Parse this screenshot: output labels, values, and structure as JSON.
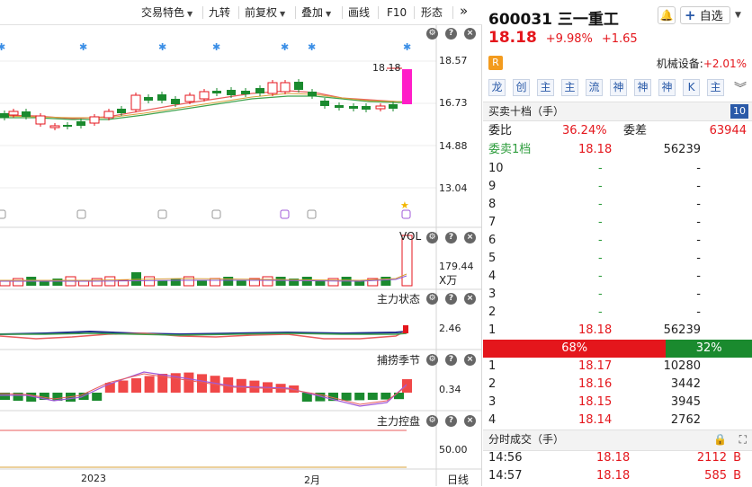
{
  "toolbar": {
    "trade_features": "交易特色",
    "nine_turns": "九转",
    "forward_adjust": "前复权",
    "overlay": "叠加",
    "draw_line": "画线",
    "f10": "F10",
    "pattern": "形态",
    "expand_icon": "double-chevron-right-icon"
  },
  "main_chart": {
    "y_ticks": [
      "18.57",
      "16.73",
      "14.88",
      "13.04"
    ],
    "last_price_label": "18.18",
    "ohlc_note": "candlestick daily bars"
  },
  "vol_panel": {
    "title": "VOL",
    "value": "179.44",
    "unit": "X万"
  },
  "main_force_panel": {
    "title": "主力状态",
    "value": "2.46"
  },
  "season_panel": {
    "title": "捕捞季节",
    "value": "0.34"
  },
  "control_panel": {
    "title": "主力控盘",
    "value": "50.00"
  },
  "x_axis": {
    "labels": [
      "2023",
      "2月"
    ],
    "period": "日线"
  },
  "stock": {
    "code": "600031",
    "name": "三一重工",
    "price": "18.18",
    "change_pct": "+9.98%",
    "change_amt": "+1.65",
    "badge": "R",
    "sector": "机械设备:",
    "sector_change": "+2.01%",
    "watchlist_button": "自选",
    "bell_icon": "bell-icon"
  },
  "feature_buttons": [
    "龙",
    "创",
    "主",
    "主",
    "流",
    "神",
    "神",
    "神",
    "K",
    "主"
  ],
  "order_book": {
    "title": "买卖十档（手）",
    "count_badge": "10",
    "ratio_label": "委比",
    "ratio_value": "36.24%",
    "diff_label": "委差",
    "diff_value": "63944",
    "sell1_label": "委卖1档",
    "sell1_price": "18.18",
    "sell1_vol": "56239",
    "asks": [
      {
        "level": "10",
        "price": "-",
        "vol": "-"
      },
      {
        "level": "9",
        "price": "-",
        "vol": "-"
      },
      {
        "level": "8",
        "price": "-",
        "vol": "-"
      },
      {
        "level": "7",
        "price": "-",
        "vol": "-"
      },
      {
        "level": "6",
        "price": "-",
        "vol": "-"
      },
      {
        "level": "5",
        "price": "-",
        "vol": "-"
      },
      {
        "level": "4",
        "price": "-",
        "vol": "-"
      },
      {
        "level": "3",
        "price": "-",
        "vol": "-"
      },
      {
        "level": "2",
        "price": "-",
        "vol": "-"
      },
      {
        "level": "1",
        "price": "18.18",
        "vol": "56239"
      }
    ],
    "buy_pct": "68%",
    "sell_pct": "32%",
    "buy_share": 0.68,
    "bids": [
      {
        "level": "1",
        "price": "18.17",
        "vol": "10280"
      },
      {
        "level": "2",
        "price": "18.16",
        "vol": "3442"
      },
      {
        "level": "3",
        "price": "18.15",
        "vol": "3945"
      },
      {
        "level": "4",
        "price": "18.14",
        "vol": "2762"
      }
    ]
  },
  "ticks": {
    "title": "分时成交（手）",
    "rows": [
      {
        "time": "14:56",
        "price": "18.18",
        "vol": "2112",
        "side": "B"
      },
      {
        "time": "14:57",
        "price": "18.18",
        "vol": "585",
        "side": "B"
      }
    ]
  },
  "colors": {
    "up": "#e4161c",
    "down": "#1a8a2e",
    "accent": "#2a5aa8"
  }
}
